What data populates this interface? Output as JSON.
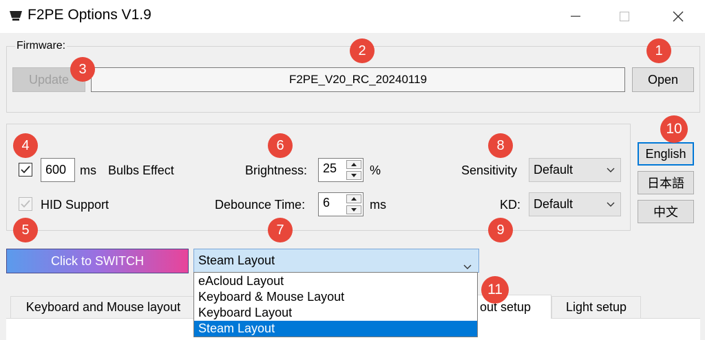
{
  "window": {
    "title": "F2PE Options V1.9",
    "app_icon": "keyboard-logo-icon",
    "controls": [
      "minimize-icon",
      "maximize-icon",
      "close-icon"
    ]
  },
  "firmware": {
    "legend": "Firmware:",
    "update_label": "Update",
    "version": "F2PE_V20_RC_20240119",
    "open_label": "Open"
  },
  "settings": {
    "bulbs_checked": true,
    "bulbs_ms": "600",
    "ms_unit": "ms",
    "bulbs_label": "Bulbs Effect",
    "hid_checked": true,
    "hid_label": "HID Support",
    "brightness_label": "Brightness:",
    "brightness_value": "25",
    "percent_unit": "%",
    "debounce_label": "Debounce Time:",
    "debounce_value": "6",
    "debounce_unit": "ms",
    "sensitivity_label": "Sensitivity",
    "sensitivity_value": "Default",
    "kd_label": "KD:",
    "kd_value": "Default"
  },
  "language": {
    "english": "English",
    "japanese": "日本語",
    "chinese": "中文"
  },
  "switch": {
    "label": "Click to SWITCH"
  },
  "layout": {
    "selected": "Steam Layout",
    "options": [
      "eAcloud Layout",
      "Keyboard & Mouse Layout",
      "Keyboard Layout",
      "Steam Layout"
    ]
  },
  "tabs": {
    "keyboard_mouse": "Keyboard and Mouse layout",
    "layout_setup": "out setup",
    "light_setup": "Light setup"
  },
  "callouts": [
    "1",
    "2",
    "3",
    "4",
    "5",
    "6",
    "7",
    "8",
    "9",
    "10",
    "11"
  ],
  "colors": {
    "callout": "#e8473a",
    "selection": "#0078d7",
    "switch_gradient_start": "#5b9bec",
    "switch_gradient_end": "#e8449a"
  }
}
